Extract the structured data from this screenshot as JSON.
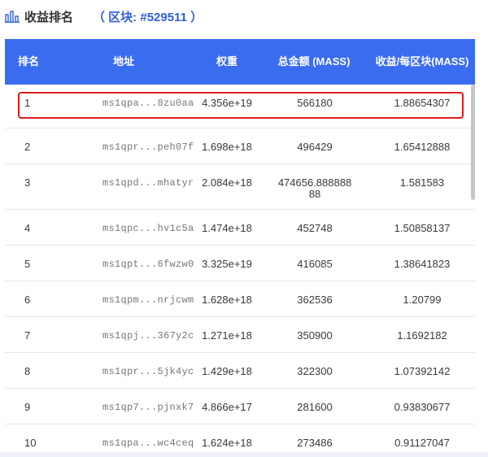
{
  "header": {
    "icon": "bar-chart-icon",
    "title": "收益排名",
    "block": "（ 区块: #529511 ）"
  },
  "columns": {
    "rank": "排名",
    "address": "地址",
    "weight": "权重",
    "total": "总金额 (MASS)",
    "yield": "收益/每区块(MASS)"
  },
  "rows": [
    {
      "rank": "1",
      "address": "ms1qpa...8zu0aa",
      "weight": "4.356e+19",
      "total": "566180",
      "yield": "1.88654307"
    },
    {
      "rank": "2",
      "address": "ms1qpr...peh07f",
      "weight": "1.698e+18",
      "total": "496429",
      "yield": "1.65412888"
    },
    {
      "rank": "3",
      "address": "ms1qpd...mhatyr",
      "weight": "2.084e+18",
      "total": "474656.88888888",
      "yield": "1.581583"
    },
    {
      "rank": "4",
      "address": "ms1qpc...hv1c5a",
      "weight": "1.474e+18",
      "total": "452748",
      "yield": "1.50858137"
    },
    {
      "rank": "5",
      "address": "ms1qpt...6fwzw0",
      "weight": "3.325e+19",
      "total": "416085",
      "yield": "1.38641823"
    },
    {
      "rank": "6",
      "address": "ms1qpm...nrjcwm",
      "weight": "1.628e+18",
      "total": "362536",
      "yield": "1.20799"
    },
    {
      "rank": "7",
      "address": "ms1qpj...367y2c",
      "weight": "1.271e+18",
      "total": "350900",
      "yield": "1.1692182"
    },
    {
      "rank": "8",
      "address": "ms1qpr...5jk4yc",
      "weight": "1.429e+18",
      "total": "322300",
      "yield": "1.07392142"
    },
    {
      "rank": "9",
      "address": "ms1qp7...pjnxk7",
      "weight": "4.866e+17",
      "total": "281600",
      "yield": "0.93830677"
    },
    {
      "rank": "10",
      "address": "ms1qpa...wc4ceq",
      "weight": "1.624e+18",
      "total": "273486",
      "yield": "0.91127047"
    }
  ],
  "colors": {
    "header_bg": "#3a6cf0",
    "accent_text": "#2f5fd8",
    "highlight": "#e21b1b"
  }
}
